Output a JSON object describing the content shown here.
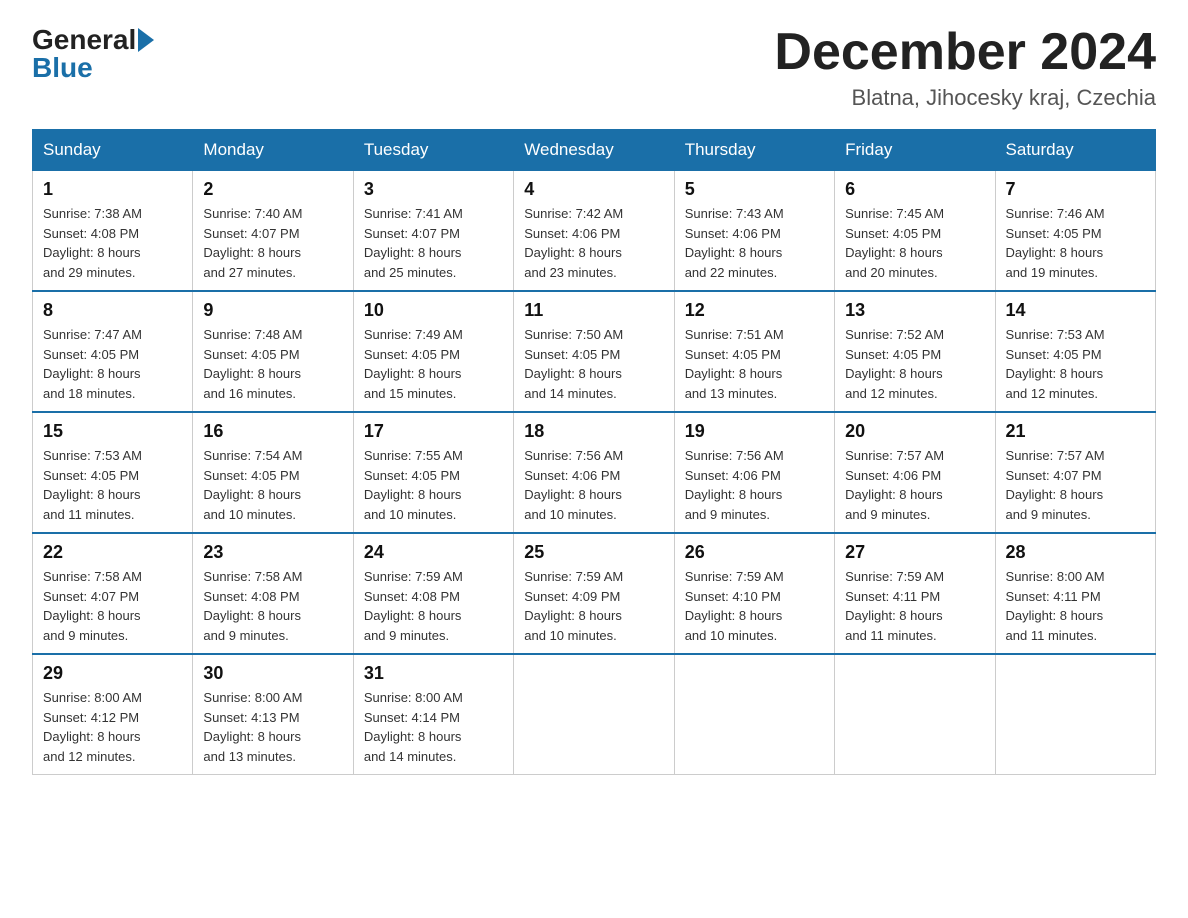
{
  "logo": {
    "general": "General",
    "blue": "Blue"
  },
  "title": "December 2024",
  "location": "Blatna, Jihocesky kraj, Czechia",
  "days_header": [
    "Sunday",
    "Monday",
    "Tuesday",
    "Wednesday",
    "Thursday",
    "Friday",
    "Saturday"
  ],
  "weeks": [
    [
      {
        "day": "1",
        "sunrise": "7:38 AM",
        "sunset": "4:08 PM",
        "daylight": "8 hours and 29 minutes."
      },
      {
        "day": "2",
        "sunrise": "7:40 AM",
        "sunset": "4:07 PM",
        "daylight": "8 hours and 27 minutes."
      },
      {
        "day": "3",
        "sunrise": "7:41 AM",
        "sunset": "4:07 PM",
        "daylight": "8 hours and 25 minutes."
      },
      {
        "day": "4",
        "sunrise": "7:42 AM",
        "sunset": "4:06 PM",
        "daylight": "8 hours and 23 minutes."
      },
      {
        "day": "5",
        "sunrise": "7:43 AM",
        "sunset": "4:06 PM",
        "daylight": "8 hours and 22 minutes."
      },
      {
        "day": "6",
        "sunrise": "7:45 AM",
        "sunset": "4:05 PM",
        "daylight": "8 hours and 20 minutes."
      },
      {
        "day": "7",
        "sunrise": "7:46 AM",
        "sunset": "4:05 PM",
        "daylight": "8 hours and 19 minutes."
      }
    ],
    [
      {
        "day": "8",
        "sunrise": "7:47 AM",
        "sunset": "4:05 PM",
        "daylight": "8 hours and 18 minutes."
      },
      {
        "day": "9",
        "sunrise": "7:48 AM",
        "sunset": "4:05 PM",
        "daylight": "8 hours and 16 minutes."
      },
      {
        "day": "10",
        "sunrise": "7:49 AM",
        "sunset": "4:05 PM",
        "daylight": "8 hours and 15 minutes."
      },
      {
        "day": "11",
        "sunrise": "7:50 AM",
        "sunset": "4:05 PM",
        "daylight": "8 hours and 14 minutes."
      },
      {
        "day": "12",
        "sunrise": "7:51 AM",
        "sunset": "4:05 PM",
        "daylight": "8 hours and 13 minutes."
      },
      {
        "day": "13",
        "sunrise": "7:52 AM",
        "sunset": "4:05 PM",
        "daylight": "8 hours and 12 minutes."
      },
      {
        "day": "14",
        "sunrise": "7:53 AM",
        "sunset": "4:05 PM",
        "daylight": "8 hours and 12 minutes."
      }
    ],
    [
      {
        "day": "15",
        "sunrise": "7:53 AM",
        "sunset": "4:05 PM",
        "daylight": "8 hours and 11 minutes."
      },
      {
        "day": "16",
        "sunrise": "7:54 AM",
        "sunset": "4:05 PM",
        "daylight": "8 hours and 10 minutes."
      },
      {
        "day": "17",
        "sunrise": "7:55 AM",
        "sunset": "4:05 PM",
        "daylight": "8 hours and 10 minutes."
      },
      {
        "day": "18",
        "sunrise": "7:56 AM",
        "sunset": "4:06 PM",
        "daylight": "8 hours and 10 minutes."
      },
      {
        "day": "19",
        "sunrise": "7:56 AM",
        "sunset": "4:06 PM",
        "daylight": "8 hours and 9 minutes."
      },
      {
        "day": "20",
        "sunrise": "7:57 AM",
        "sunset": "4:06 PM",
        "daylight": "8 hours and 9 minutes."
      },
      {
        "day": "21",
        "sunrise": "7:57 AM",
        "sunset": "4:07 PM",
        "daylight": "8 hours and 9 minutes."
      }
    ],
    [
      {
        "day": "22",
        "sunrise": "7:58 AM",
        "sunset": "4:07 PM",
        "daylight": "8 hours and 9 minutes."
      },
      {
        "day": "23",
        "sunrise": "7:58 AM",
        "sunset": "4:08 PM",
        "daylight": "8 hours and 9 minutes."
      },
      {
        "day": "24",
        "sunrise": "7:59 AM",
        "sunset": "4:08 PM",
        "daylight": "8 hours and 9 minutes."
      },
      {
        "day": "25",
        "sunrise": "7:59 AM",
        "sunset": "4:09 PM",
        "daylight": "8 hours and 10 minutes."
      },
      {
        "day": "26",
        "sunrise": "7:59 AM",
        "sunset": "4:10 PM",
        "daylight": "8 hours and 10 minutes."
      },
      {
        "day": "27",
        "sunrise": "7:59 AM",
        "sunset": "4:11 PM",
        "daylight": "8 hours and 11 minutes."
      },
      {
        "day": "28",
        "sunrise": "8:00 AM",
        "sunset": "4:11 PM",
        "daylight": "8 hours and 11 minutes."
      }
    ],
    [
      {
        "day": "29",
        "sunrise": "8:00 AM",
        "sunset": "4:12 PM",
        "daylight": "8 hours and 12 minutes."
      },
      {
        "day": "30",
        "sunrise": "8:00 AM",
        "sunset": "4:13 PM",
        "daylight": "8 hours and 13 minutes."
      },
      {
        "day": "31",
        "sunrise": "8:00 AM",
        "sunset": "4:14 PM",
        "daylight": "8 hours and 14 minutes."
      },
      null,
      null,
      null,
      null
    ]
  ],
  "labels": {
    "sunrise": "Sunrise: ",
    "sunset": "Sunset: ",
    "daylight": "Daylight: "
  }
}
